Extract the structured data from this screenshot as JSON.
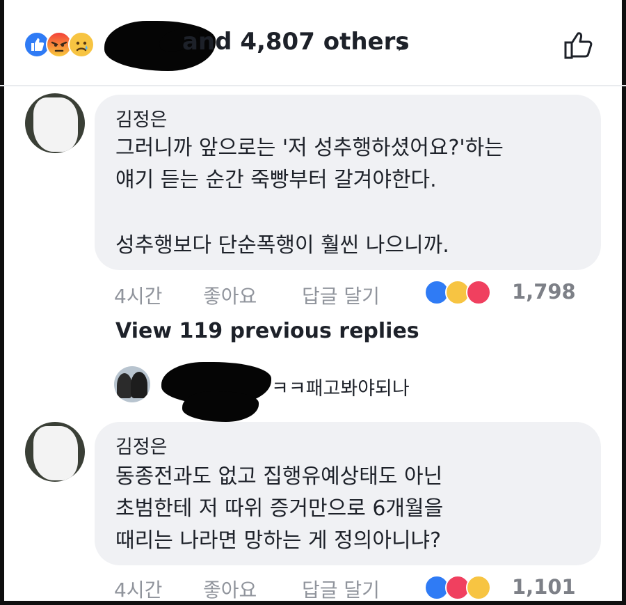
{
  "header": {
    "names_text": "and 4,807 others",
    "reactions": [
      "like-icon",
      "angry-icon",
      "sad-icon"
    ],
    "chevron": "›"
  },
  "comments": [
    {
      "author": "김정은",
      "lines": [
        "그러니까 앞으로는 '저 성추행하셨어요?'하는",
        "얘기 듣는 순간 죽빵부터 갈겨야한다.",
        "",
        "성추행보다 단순폭행이 훨씬 나으니까."
      ],
      "time": "4시간",
      "like_label": "좋아요",
      "reply_label": "답글 달기",
      "reaction_count": "1,798"
    },
    {
      "author": "김정은",
      "lines": [
        "동종전과도 없고 집행유예상태도 아닌",
        "초범한테 저 따위 증거만으로 6개월을",
        "때리는 나라면 망하는 게 정의아니냐?"
      ],
      "time": "4시간",
      "like_label": "좋아요",
      "reply_label": "답글 달기",
      "reaction_count": "1,101"
    }
  ],
  "replies": {
    "view_previous": "View 119 previous replies",
    "latest_text": "ㅋㅋ패고봐야되나"
  },
  "colors": {
    "like_blue": "#2f7bf5",
    "bubble_bg": "#f0f1f4",
    "meta_gray": "#90949c"
  }
}
